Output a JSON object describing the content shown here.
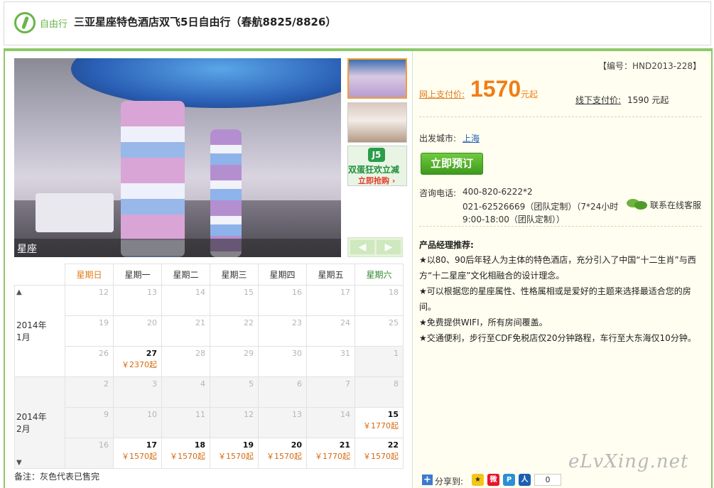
{
  "header": {
    "tag": "自由行",
    "title": "三亚星座特色酒店双飞5日自由行（春航8825/8826）"
  },
  "gallery": {
    "caption": "星座",
    "thumbnails": [
      "hotel-lobby",
      "hotel-room",
      "promo-banner"
    ],
    "promo": {
      "logo": "J5",
      "line1": "双蛋狂欢立减",
      "line2": "立即抢购 ›"
    },
    "prev_label": "◀",
    "next_label": "▶"
  },
  "calendar": {
    "weekdays": [
      "星期日",
      "星期一",
      "星期二",
      "星期三",
      "星期四",
      "星期五",
      "星期六"
    ],
    "months": [
      {
        "label_year": "2014年",
        "label_month": "1月",
        "weeks": [
          [
            {
              "d": "12"
            },
            {
              "d": "13"
            },
            {
              "d": "14"
            },
            {
              "d": "15"
            },
            {
              "d": "16"
            },
            {
              "d": "17"
            },
            {
              "d": "18"
            }
          ],
          [
            {
              "d": "19"
            },
            {
              "d": "20"
            },
            {
              "d": "21"
            },
            {
              "d": "22"
            },
            {
              "d": "23"
            },
            {
              "d": "24"
            },
            {
              "d": "25"
            }
          ],
          [
            {
              "d": "26"
            },
            {
              "d": "27",
              "price": "￥2370起"
            },
            {
              "d": "28"
            },
            {
              "d": "29"
            },
            {
              "d": "30"
            },
            {
              "d": "31"
            },
            {
              "d": "1",
              "gray": true
            }
          ]
        ]
      },
      {
        "label_year": "2014年",
        "label_month": "2月",
        "weeks": [
          [
            {
              "d": "2",
              "gray": true
            },
            {
              "d": "3",
              "gray": true
            },
            {
              "d": "4",
              "gray": true
            },
            {
              "d": "5",
              "gray": true
            },
            {
              "d": "6",
              "gray": true
            },
            {
              "d": "7",
              "gray": true
            },
            {
              "d": "8",
              "gray": true
            }
          ],
          [
            {
              "d": "9",
              "gray": true
            },
            {
              "d": "10",
              "gray": true
            },
            {
              "d": "11",
              "gray": true
            },
            {
              "d": "12",
              "gray": true
            },
            {
              "d": "13",
              "gray": true
            },
            {
              "d": "14",
              "gray": true
            },
            {
              "d": "15",
              "price": "￥1770起"
            }
          ],
          [
            {
              "d": "16",
              "gray": true
            },
            {
              "d": "17",
              "price": "￥1570起"
            },
            {
              "d": "18",
              "price": "￥1570起"
            },
            {
              "d": "19",
              "price": "￥1570起"
            },
            {
              "d": "20",
              "price": "￥1570起"
            },
            {
              "d": "21",
              "price": "￥1770起"
            },
            {
              "d": "22",
              "price": "￥1570起"
            }
          ]
        ]
      }
    ],
    "footnote": "备注：灰色代表已售完"
  },
  "product": {
    "code": "【编号：HND2013-228】",
    "online_label": "网上支付价:",
    "online_price": "1570",
    "online_unit": "元起",
    "offline_label": "线下支付价:",
    "offline_price": "1590 元起",
    "depart_label": "出发城市:",
    "depart_city": "上海",
    "book_label": "立即预订",
    "tel_label": "咨询电话:",
    "tel_lines": [
      "400-820-6222*2",
      "021-62526669（团队定制）（7*24小时",
      "9:00-18:00（团队定制））"
    ],
    "chat_label": "联系在线客服",
    "reco_title": "产品经理推荐:",
    "reco_items": [
      "★以80、90后年轻人为主体的特色酒店，充分引入了中国“十二生肖”与西方“十二星座”文化相融合的设计理念。",
      "★可以根据您的星座属性、性格属相或是爱好的主题来选择最适合您的房间。",
      "★免费提供WIFI，所有房间覆盖。",
      "★交通便利，步行至CDF免税店仅20分钟路程，车行至大东海仅10分钟。"
    ],
    "share_label": "分享到:",
    "share_count": "0"
  },
  "colors": {
    "brand_green": "#69b548",
    "price_orange": "#f07d16",
    "link_blue": "#1f5fb4",
    "panel_bg": "#fffef0"
  },
  "watermark": "eLvXing.net"
}
